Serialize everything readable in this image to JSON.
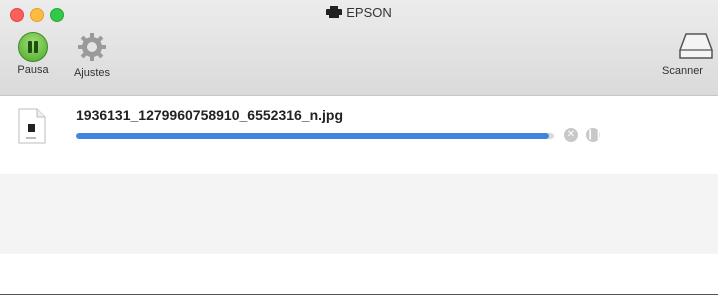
{
  "window": {
    "title": "EPSON"
  },
  "toolbar": {
    "pause_label": "Pausa",
    "settings_label": "Ajustes",
    "scanner_label": "Scanner"
  },
  "files": [
    {
      "name": "1936131_1279960758910_6552316_n.jpg",
      "progress": 0.99
    }
  ],
  "colors": {
    "progress": "#3f86e0",
    "pause_button": "#4ea62d"
  },
  "icons": [
    "printer-icon",
    "pause-icon",
    "gear-icon",
    "scanner-icon",
    "jpg-file-icon",
    "stop-icon",
    "pause-small-icon"
  ]
}
